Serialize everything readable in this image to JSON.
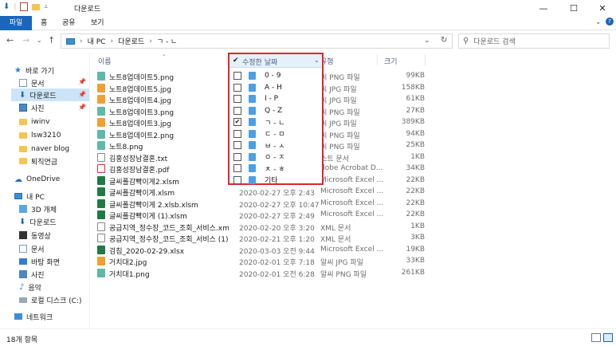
{
  "window": {
    "title": "다운로드"
  },
  "ribbon": {
    "tabs": [
      "파일",
      "홈",
      "공유",
      "보기"
    ]
  },
  "address": {
    "path": [
      "내 PC",
      "다운로드",
      "ㄱ - ㄴ"
    ],
    "search_placeholder": "다운로드 검색"
  },
  "navpane": {
    "items": [
      {
        "label": "바로 가기"
      },
      {
        "label": "문서"
      },
      {
        "label": "다운로드"
      },
      {
        "label": "사진"
      },
      {
        "label": "iwinv"
      },
      {
        "label": "lsw3210"
      },
      {
        "label": "naver blog"
      },
      {
        "label": "퇴직연금"
      },
      {
        "label": "OneDrive"
      },
      {
        "label": "내 PC"
      },
      {
        "label": "3D 개체"
      },
      {
        "label": "다운로드"
      },
      {
        "label": "동영상"
      },
      {
        "label": "문서"
      },
      {
        "label": "바탕 화면"
      },
      {
        "label": "사진"
      },
      {
        "label": "음악"
      },
      {
        "label": "로컬 디스크 (C:)"
      },
      {
        "label": "네트워크"
      }
    ]
  },
  "columns": {
    "name": "이름",
    "date": "수정한 날짜",
    "type": "유형",
    "size": "크기"
  },
  "files": [
    {
      "name": "노트8업데이트5.png",
      "date": "",
      "type": "씨 PNG 파일",
      "size": "99KB"
    },
    {
      "name": "노트8업데이트5.jpg",
      "date": "",
      "type": "씨 JPG 파일",
      "size": "158KB"
    },
    {
      "name": "노트8업데이트4.jpg",
      "date": "",
      "type": "씨 JPG 파일",
      "size": "61KB"
    },
    {
      "name": "노트8업데이트3.png",
      "date": "",
      "type": "씨 PNG 파일",
      "size": "27KB"
    },
    {
      "name": "노트8업데이트3.jpg",
      "date": "",
      "type": "씨 JPG 파일",
      "size": "389KB"
    },
    {
      "name": "노트8업데이트2.png",
      "date": "",
      "type": "씨 PNG 파일",
      "size": "94KB"
    },
    {
      "name": "노트8.png",
      "date": "",
      "type": "씨 PNG 파일",
      "size": "25KB"
    },
    {
      "name": "김홍성장남결혼.txt",
      "date": "",
      "type": "스트 문서",
      "size": "1KB"
    },
    {
      "name": "김홍성장남결혼.pdf",
      "date": "",
      "type": "dobe Acrobat D...",
      "size": "34KB"
    },
    {
      "name": "글씨폴감빡이게2.xlsm",
      "date": "",
      "type": "Microsoft Excel ...",
      "size": "22KB"
    },
    {
      "name": "글씨폴감빡이게.xlsm",
      "date": "2020-02-27 오후 2:43",
      "type": "Microsoft Excel ...",
      "size": "22KB"
    },
    {
      "name": "글씨폴감빡이게 2.xlsb.xlsm",
      "date": "2020-02-27 오후 10:47",
      "type": "Microsoft Excel ...",
      "size": "22KB"
    },
    {
      "name": "글씨폴감빡이게 (1).xlsm",
      "date": "2020-02-27 오후 2:49",
      "type": "Microsoft Excel ...",
      "size": "22KB"
    },
    {
      "name": "공급지역_정수장_코드_조회_서비스.xml",
      "date": "2020-02-20 오후 3:20",
      "type": "XML 문서",
      "size": "1KB"
    },
    {
      "name": "공급지역_정수장_코드_조회_서비스 (1).x...",
      "date": "2020-02-21 오후 1:20",
      "type": "XML 문서",
      "size": "3KB"
    },
    {
      "name": "검침_2020-02-29.xlsx",
      "date": "2020-03-03 오전 9:44",
      "type": "Microsoft Excel ...",
      "size": "19KB"
    },
    {
      "name": "거치대2.jpg",
      "date": "2020-02-01 오후 7:18",
      "type": "알씨 JPG 파일",
      "size": "33KB"
    },
    {
      "name": "거치대1.png",
      "date": "2020-02-01 오전 6:28",
      "type": "알씨 PNG 파일",
      "size": "261KB"
    }
  ],
  "date_filter": {
    "header": "수정한 날짜",
    "options": [
      {
        "label": "0 - 9",
        "checked": false
      },
      {
        "label": "A - H",
        "checked": false
      },
      {
        "label": "I - P",
        "checked": false
      },
      {
        "label": "Q - Z",
        "checked": false
      },
      {
        "label": "ㄱ - ㄴ",
        "checked": true
      },
      {
        "label": "ㄷ - ㅁ",
        "checked": false
      },
      {
        "label": "ㅂ - ㅅ",
        "checked": false
      },
      {
        "label": "ㅇ - ㅈ",
        "checked": false
      },
      {
        "label": "ㅊ - ㅎ",
        "checked": false
      },
      {
        "label": "기타",
        "checked": false
      }
    ]
  },
  "status": {
    "count": "18개 항목"
  },
  "colors": {
    "accent": "#1a66b8",
    "selection": "#cce4f7",
    "highlight_border": "#e0262a",
    "folder": "#f4c551"
  }
}
